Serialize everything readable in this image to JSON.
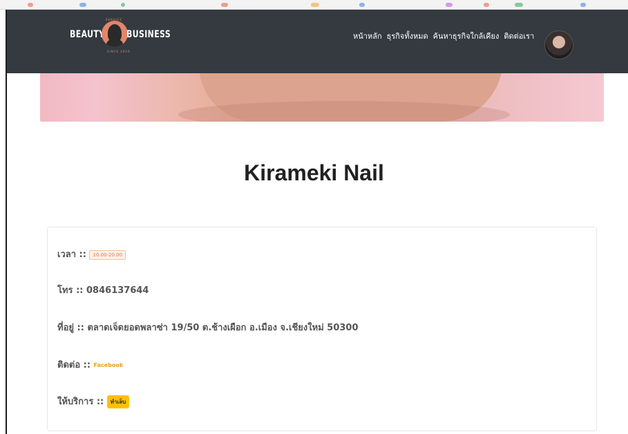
{
  "header": {
    "brand": {
      "word_left": "BEAUTY",
      "word_right": "BUSINESS",
      "tag_top": "SERVICE",
      "tag_bottom": "SINCE 2020"
    },
    "nav": [
      {
        "label": "หน้าหลัก"
      },
      {
        "label": "ธุรกิจทั้งหมด"
      },
      {
        "label": "ค้นหาธุรกิจใกล้เคียง"
      },
      {
        "label": "ติดต่อเรา"
      }
    ]
  },
  "shop": {
    "name": "Kirameki Nail",
    "hours_label": "เวลา",
    "hours_value": "10.00-20.00",
    "phone_label": "โทร",
    "phone_value": "0846137644",
    "address_label": "ที่อยู่",
    "address_value": "ตลาดเจ็ดยอดพลาซ่า 19/50 ต.ช้างเผือก อ.เมือง จ.เชียงใหม่ 50300",
    "contact_label": "ติดต่อ",
    "contact_value": "Facebook",
    "service_label": "ให้บริการ",
    "service_value": "ทำเล็บ"
  },
  "colors": {
    "navbar_bg": "#343a40",
    "accent_orange": "#f39c12",
    "service_badge": "#ffc107"
  }
}
